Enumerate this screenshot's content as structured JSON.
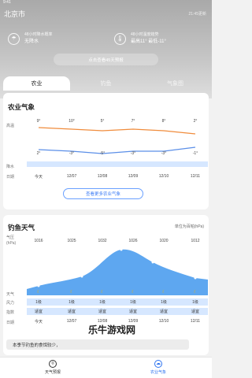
{
  "status": {
    "time": "9:41"
  },
  "header": {
    "city": "北京市",
    "updated": "21:45更新"
  },
  "cards": [
    {
      "label": "48小时降水概率",
      "value": "无降水"
    },
    {
      "label": "48小时温度趋势",
      "value": "最高11° 最低-11°"
    }
  ],
  "btn45": "点击查看45天预报",
  "tabs": [
    "农业",
    "钓鱼",
    "气象图"
  ],
  "agri": {
    "title": "农业气象",
    "row_labels": {
      "high": "高温",
      "low": "低温",
      "wind": "降水",
      "date": "日期"
    },
    "highs": [
      "9°",
      "10°",
      "5°",
      "7°",
      "8°",
      "2°"
    ],
    "lows": [
      "2°",
      "-3°",
      "-5°",
      "-3°",
      "-3°",
      "-1°"
    ],
    "dates": [
      "今天",
      "12/07",
      "12/08",
      "12/09",
      "12/10",
      "12/11"
    ],
    "more": "查看更多农业气象"
  },
  "fish": {
    "title": "钓鱼天气",
    "note": "单位为百帕(hPa)",
    "axis_label": "气压\n(hPa)",
    "pressures": [
      "1016",
      "1025",
      "1032",
      "1026",
      "1020",
      "1012"
    ],
    "row_labels": {
      "weather": "天气",
      "wind": "风力",
      "level": "指数",
      "date": "日期"
    },
    "wind": [
      "1级",
      "1级",
      "1级",
      "1级",
      "1级",
      "1级"
    ],
    "level": [
      "适宜",
      "适宜",
      "适宜",
      "适宜",
      "适宜",
      "适宜"
    ],
    "dates": [
      "今天",
      "12/07",
      "12/08",
      "12/09",
      "12/10",
      "12/11"
    ],
    "notice": "本季节钓鱼的食饵较少，"
  },
  "nav": [
    {
      "label": "天气预报"
    },
    {
      "label": "农业气象"
    }
  ],
  "watermark": "乐牛游戏网"
}
